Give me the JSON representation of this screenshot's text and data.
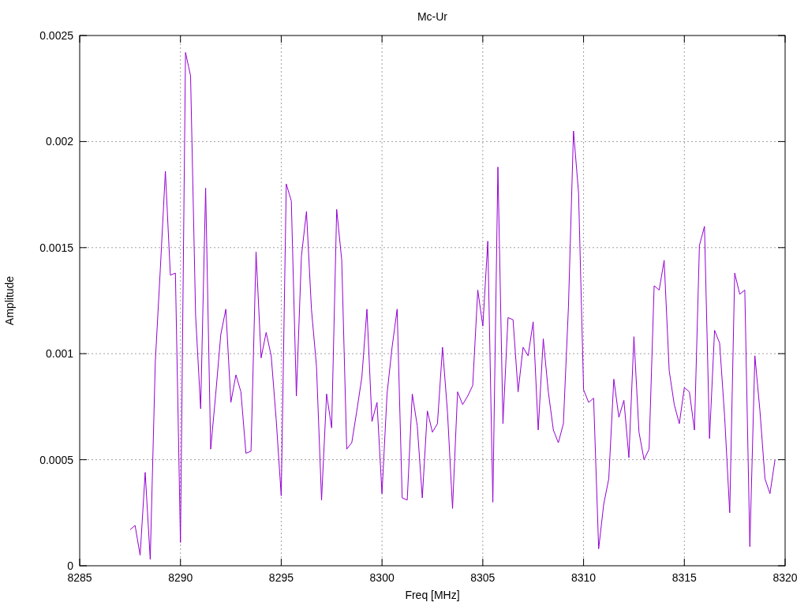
{
  "chart_data": {
    "type": "line",
    "title": "Mc-Ur",
    "xlabel": "Freq [MHz]",
    "ylabel": "Amplitude",
    "x": [
      8287.5,
      8287.75,
      8288,
      8288.25,
      8288.5,
      8288.75,
      8289,
      8289.25,
      8289.5,
      8289.75,
      8290,
      8290.25,
      8290.5,
      8290.75,
      8291,
      8291.25,
      8291.5,
      8291.75,
      8292,
      8292.25,
      8292.5,
      8292.75,
      8293,
      8293.25,
      8293.5,
      8293.75,
      8294,
      8294.25,
      8294.5,
      8294.75,
      8295,
      8295.25,
      8295.5,
      8295.75,
      8296,
      8296.25,
      8296.5,
      8296.75,
      8297,
      8297.25,
      8297.5,
      8297.75,
      8298,
      8298.25,
      8298.5,
      8298.75,
      8299,
      8299.25,
      8299.5,
      8299.75,
      8300,
      8300.25,
      8300.5,
      8300.75,
      8301,
      8301.25,
      8301.5,
      8301.75,
      8302,
      8302.25,
      8302.5,
      8302.75,
      8303,
      8303.25,
      8303.5,
      8303.75,
      8304,
      8304.25,
      8304.5,
      8304.75,
      8305,
      8305.25,
      8305.5,
      8305.75,
      8306,
      8306.25,
      8306.5,
      8306.75,
      8307,
      8307.25,
      8307.5,
      8307.75,
      8308,
      8308.25,
      8308.5,
      8308.75,
      8309,
      8309.25,
      8309.5,
      8309.75,
      8310,
      8310.25,
      8310.5,
      8310.75,
      8311,
      8311.25,
      8311.5,
      8311.75,
      8312,
      8312.25,
      8312.5,
      8312.75,
      8313,
      8313.25,
      8313.5,
      8313.75,
      8314,
      8314.25,
      8314.5,
      8314.75,
      8315,
      8315.25,
      8315.5,
      8315.75,
      8316,
      8316.25,
      8316.5,
      8316.75,
      8317,
      8317.25,
      8317.5,
      8317.75,
      8318,
      8318.25,
      8318.5,
      8318.75,
      8319,
      8319.25,
      8319.5
    ],
    "series": [
      {
        "color": "#9400d3",
        "values": [
          0.00017,
          0.00019,
          5e-05,
          0.00044,
          3e-05,
          0.00096,
          0.0014,
          0.00186,
          0.00137,
          0.00138,
          0.00011,
          0.00242,
          0.00231,
          0.00118,
          0.00074,
          0.00178,
          0.00055,
          0.00081,
          0.00109,
          0.00121,
          0.00077,
          0.0009,
          0.00082,
          0.00053,
          0.00054,
          0.00148,
          0.00098,
          0.0011,
          0.00099,
          0.00069,
          0.00033,
          0.0018,
          0.00172,
          0.0008,
          0.00146,
          0.00167,
          0.00121,
          0.00094,
          0.00031,
          0.00081,
          0.00065,
          0.00168,
          0.00144,
          0.00055,
          0.00058,
          0.00073,
          0.00089,
          0.00121,
          0.00068,
          0.00077,
          0.00034,
          0.00081,
          0.00103,
          0.00121,
          0.00032,
          0.00031,
          0.00081,
          0.00066,
          0.00032,
          0.00073,
          0.00063,
          0.00067,
          0.00103,
          0.00072,
          0.00027,
          0.00082,
          0.00076,
          0.0008,
          0.00085,
          0.0013,
          0.00113,
          0.00153,
          0.0003,
          0.00188,
          0.00067,
          0.00117,
          0.00116,
          0.00082,
          0.00103,
          0.00099,
          0.00115,
          0.00064,
          0.00107,
          0.00082,
          0.00064,
          0.00058,
          0.00067,
          0.00122,
          0.00205,
          0.00176,
          0.00083,
          0.00077,
          0.00079,
          8e-05,
          0.00029,
          0.00041,
          0.00088,
          0.0007,
          0.00078,
          0.00051,
          0.00108,
          0.00063,
          0.0005,
          0.00055,
          0.00132,
          0.0013,
          0.00144,
          0.00092,
          0.00076,
          0.00067,
          0.00084,
          0.00082,
          0.00064,
          0.00151,
          0.0016,
          0.0006,
          0.00111,
          0.00105,
          0.0007,
          0.00025,
          0.00138,
          0.00128,
          0.0013,
          9e-05,
          0.00099,
          0.00073,
          0.00041,
          0.00034,
          0.0005
        ]
      }
    ],
    "grid": true,
    "xlim": [
      8285,
      8320
    ],
    "ylim": [
      0,
      0.0025
    ],
    "xticks": [
      8285,
      8290,
      8295,
      8300,
      8305,
      8310,
      8315,
      8320
    ],
    "yticks": [
      {
        "value": 0,
        "label": "0"
      },
      {
        "value": 0.0005,
        "label": "0.0005"
      },
      {
        "value": 0.001,
        "label": "0.001"
      },
      {
        "value": 0.0015,
        "label": "0.0015"
      },
      {
        "value": 0.002,
        "label": "0.002"
      },
      {
        "value": 0.0025,
        "label": "0.0025"
      }
    ]
  }
}
